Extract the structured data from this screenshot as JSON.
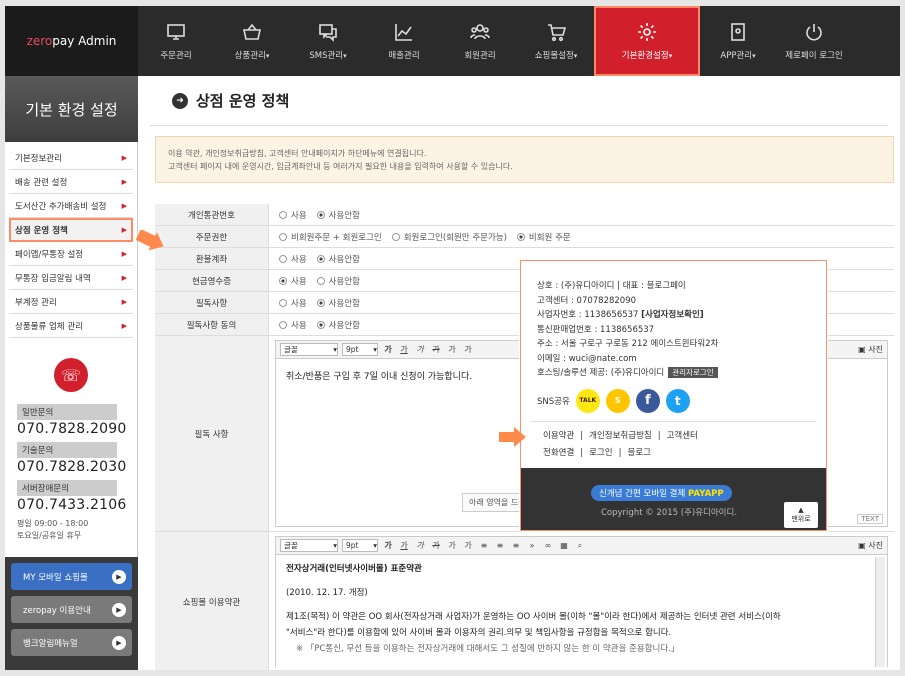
{
  "logo": {
    "prefix": "zero",
    "rest": "pay Admin"
  },
  "nav": [
    {
      "label": "주문관리",
      "icon": "monitor-icon",
      "caret": ""
    },
    {
      "label": "상품관리",
      "icon": "basket-icon",
      "caret": "▾"
    },
    {
      "label": "SMS관리",
      "icon": "chat-icon",
      "caret": "▾"
    },
    {
      "label": "매출관리",
      "icon": "chart-icon",
      "caret": ""
    },
    {
      "label": "회원관리",
      "icon": "users-icon",
      "caret": ""
    },
    {
      "label": "쇼핑몰설정",
      "icon": "cart-icon",
      "caret": "▾"
    },
    {
      "label": "기본환경설정",
      "icon": "gear-icon",
      "caret": "▾"
    },
    {
      "label": "APP관리",
      "icon": "app-icon",
      "caret": "▾"
    },
    {
      "label": "제로페이 로그인",
      "icon": "power-icon",
      "caret": ""
    }
  ],
  "sidebar": {
    "title": "기본 환경 설정",
    "items": [
      "기본정보관리",
      "배송 관련 설정",
      "도서산간 추가배송비 설정",
      "상점 운영 정책",
      "페이앱/무통장 설정",
      "무통장 입금알림 내역",
      "부계정 관리",
      "상품물류 업체 관리"
    ],
    "active_index": 3,
    "contacts": [
      {
        "label": "일반문의",
        "number": "070.7828.2090"
      },
      {
        "label": "기술문의",
        "number": "070.7828.2030"
      },
      {
        "label": "서버장애문의",
        "number": "070.7433.2106"
      }
    ],
    "hours1": "평일 09:00 - 18:00",
    "hours2": "토요일/공휴일 휴무",
    "buttons": [
      "MY 모바일 쇼핑몰",
      "zeropay 이용안내",
      "뱅크알림메뉴얼"
    ]
  },
  "page": {
    "title": "상점 운영 정책",
    "notice1": "이용 약관, 개인정보취급방침, 고객센터 안내페이지가 하단메뉴에 연결됩니다.",
    "notice2": "고객센터 페이지 내에 운영시간, 입금계좌안내 등 여러가지 필요한 내용을 입력하여 사용할 수 있습니다."
  },
  "form": {
    "rows": [
      {
        "label": "개인통관번호",
        "options": [
          "사용",
          "사용안함"
        ],
        "selected": 1
      },
      {
        "label": "주문권한",
        "options": [
          "비회원주문 + 회원로그인",
          "회원로그인(회원만 주문가능)",
          "비회원 주문"
        ],
        "selected": 2
      },
      {
        "label": "환불계좌",
        "options": [
          "사용",
          "사용안함"
        ],
        "selected": 1
      },
      {
        "label": "현금영수증",
        "options": [
          "사용",
          "사용안함"
        ],
        "selected": 0
      },
      {
        "label": "필독사항",
        "options": [
          "사용",
          "사용안함"
        ],
        "selected": 1
      },
      {
        "label": "필독사항 동의",
        "options": [
          "사용",
          "사용안함"
        ],
        "selected": 1
      }
    ],
    "editor1": {
      "label": "필독 사항",
      "font": "글꼴",
      "size": "9pt",
      "photo": "사진",
      "body": "취소/반품은 구입 후 7일 이내 신청이 가능합니다.",
      "hint": "아래 영역을 드래",
      "text_tab": "TEXT"
    },
    "editor2": {
      "label": "쇼핑몰 이용약관",
      "font": "글꼴",
      "size": "9pt",
      "photo": "사진",
      "lines": [
        "전자상거래(인터넷사이버몰) 표준약관",
        "(2010. 12. 17. 개정)",
        "제1조(목적) 이 약관은 OO 회사(전자상거래 사업자)가 운영하는 OO 사이버 몰(이하 \"몰\"이라 한다)에서 제공하는 인터넷 관련 서비스(이하",
        "\"서비스\"라 한다)를 이용함에 있어 사이버 몰과 이용자의 권리.의무 및 책임사항을 규정함을 목적으로 합니다.",
        "※ 「PC통신, 무선 등을 이용하는 전자상거래에 대해서도 그 성질에 반하지 않는 한 이 약관을 준용합니다.」"
      ]
    }
  },
  "popup": {
    "line1": "상호 : (주)유디아이디 | 대표 : 블로그페이",
    "line2": "고객센터 : 07078282090",
    "line3a": "사업자번호 : 1138656537 ",
    "line3b": "[사업자정보확인]",
    "line4": "통신판매업번호 : 1138656537",
    "line5": "주소 : 서울 구로구 구로동 212 에이스트윈타워2차",
    "line6": "이메일 : wuci@nate.com",
    "line7": "호스팅/솔루션 제공: (주)유디아이디",
    "admin_btn": "관리자로그인",
    "sns_label": "SNS공유",
    "sns": [
      {
        "t": "TALK",
        "c": "#ffe812",
        "f": "#3c1e1e"
      },
      {
        "t": "S",
        "c": "#ffc600",
        "f": "#fff"
      },
      {
        "t": "f",
        "c": "#3b5998",
        "f": "#fff"
      },
      {
        "t": "t",
        "c": "#1da1f2",
        "f": "#fff"
      }
    ],
    "links1": [
      "이용약관",
      "개인정보취급방침",
      "고객센터"
    ],
    "links2": [
      "전화연결",
      "로그인",
      "블로그"
    ],
    "payapp_text": "신개념 간편 모바일 결제 ",
    "payapp_brand": "PAYAPP",
    "copyright": "Copyright © 2015 (주)유디아이디.",
    "top_btn": "맨위로"
  },
  "colors": {
    "accent": "#d21f2c",
    "highlight": "#ff8a66"
  }
}
